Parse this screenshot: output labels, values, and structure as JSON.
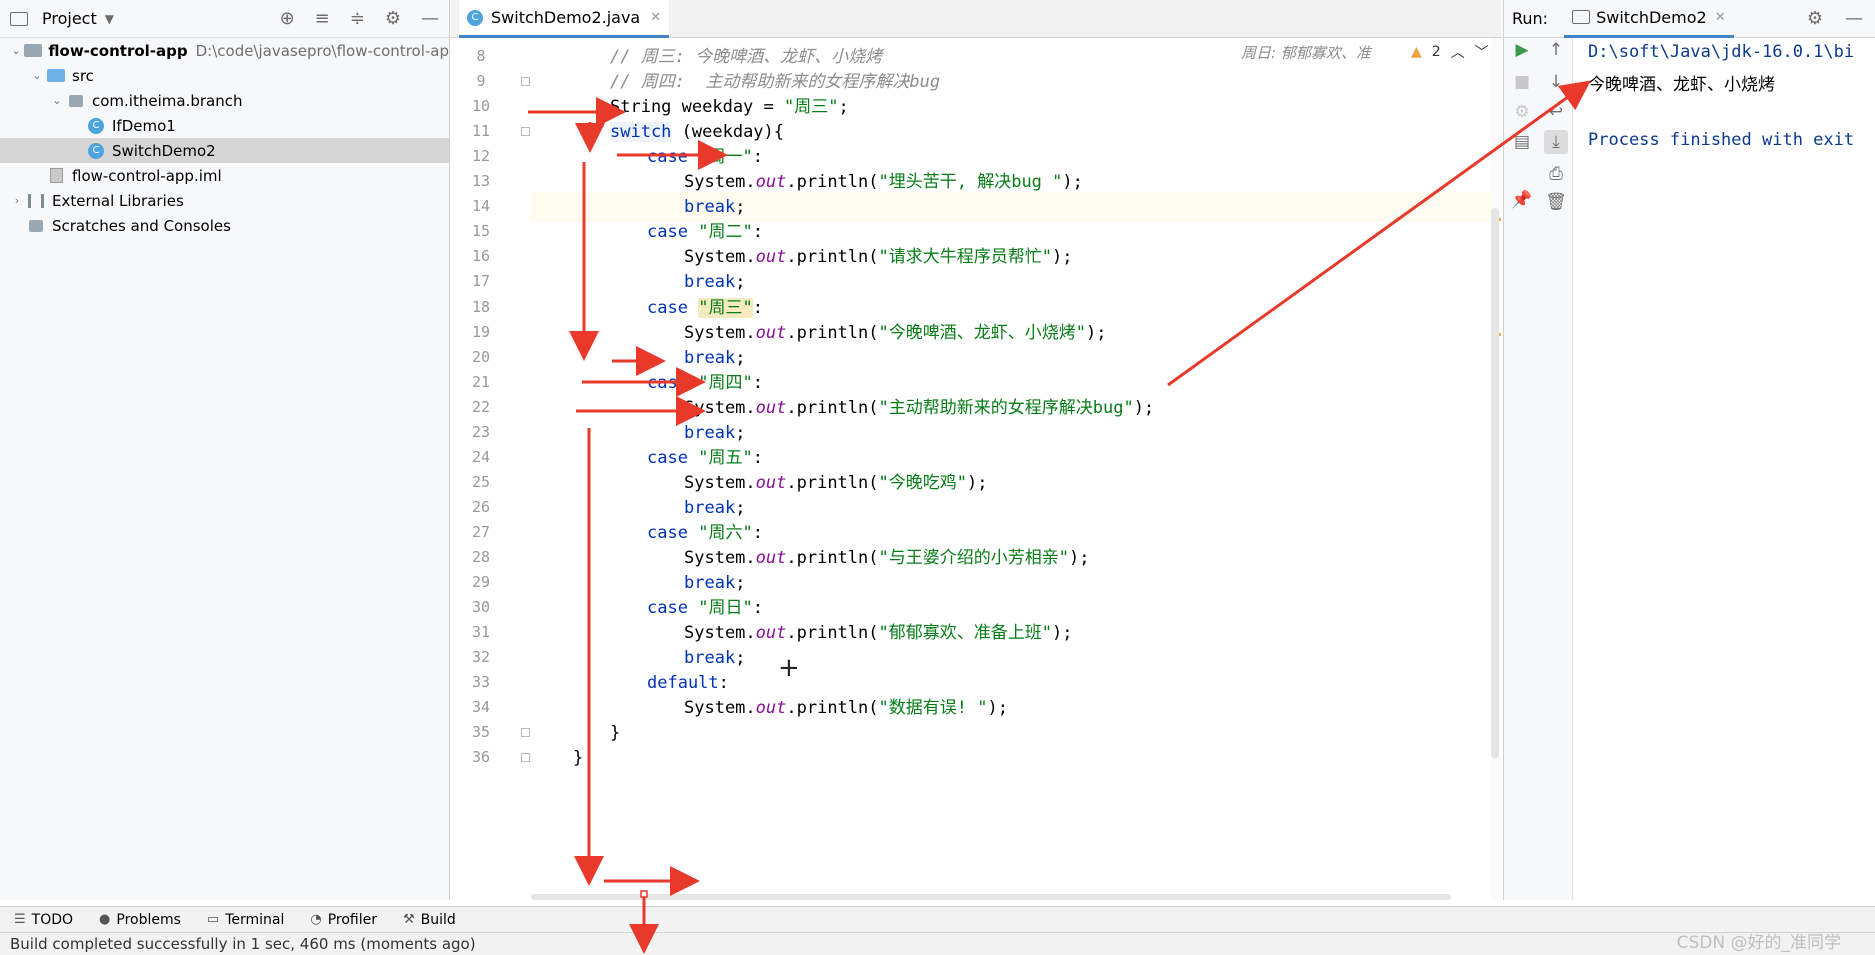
{
  "project": {
    "title": "Project",
    "tree": [
      {
        "label": "flow-control-app",
        "path": "D:\\code\\javasepro\\flow-control-ap",
        "depth": 0,
        "expanded": true,
        "type": "module"
      },
      {
        "label": "src",
        "depth": 1,
        "expanded": true,
        "type": "source-folder"
      },
      {
        "label": "com.itheima.branch",
        "depth": 2,
        "expanded": true,
        "type": "package"
      },
      {
        "label": "IfDemo1",
        "depth": 3,
        "type": "class"
      },
      {
        "label": "SwitchDemo2",
        "depth": 3,
        "type": "class",
        "selected": true
      },
      {
        "label": "flow-control-app.iml",
        "depth": 1,
        "type": "iml"
      },
      {
        "label": "External Libraries",
        "depth": 0,
        "expanded": false,
        "type": "libraries"
      },
      {
        "label": "Scratches and Consoles",
        "depth": 0,
        "type": "scratches"
      }
    ]
  },
  "editor": {
    "tab_label": "SwitchDemo2.java",
    "inlay_hint": "周日: 郁郁寡欢、准",
    "warning_count": "2",
    "lines": [
      {
        "n": "8",
        "text": "// 周三: 今晚啤酒、龙虾、小烧烤"
      },
      {
        "n": "9",
        "text": "// 周四:  主动帮助新来的女程序解决bug"
      },
      {
        "n": "10",
        "text": "String weekday = \"周三\";"
      },
      {
        "n": "11",
        "text": "switch (weekday){"
      },
      {
        "n": "12",
        "text": "case \"周一\":"
      },
      {
        "n": "13",
        "text": "System.out.println(\"埋头苦干, 解决bug \");"
      },
      {
        "n": "14",
        "text": "break;"
      },
      {
        "n": "15",
        "text": "case \"周二\":"
      },
      {
        "n": "16",
        "text": "System.out.println(\"请求大牛程序员帮忙\");"
      },
      {
        "n": "17",
        "text": "break;"
      },
      {
        "n": "18",
        "text": "case \"周三\":"
      },
      {
        "n": "19",
        "text": "System.out.println(\"今晚啤酒、龙虾、小烧烤\");"
      },
      {
        "n": "20",
        "text": "break;"
      },
      {
        "n": "21",
        "text": "case \"周四\":"
      },
      {
        "n": "22",
        "text": "System.out.println(\"主动帮助新来的女程序解决bug\");"
      },
      {
        "n": "23",
        "text": "break;"
      },
      {
        "n": "24",
        "text": "case \"周五\":"
      },
      {
        "n": "25",
        "text": "System.out.println(\"今晚吃鸡\");"
      },
      {
        "n": "26",
        "text": "break;"
      },
      {
        "n": "27",
        "text": "case \"周六\":"
      },
      {
        "n": "28",
        "text": "System.out.println(\"与王婆介绍的小芳相亲\");"
      },
      {
        "n": "29",
        "text": "break;"
      },
      {
        "n": "30",
        "text": "case \"周日\":"
      },
      {
        "n": "31",
        "text": "System.out.println(\"郁郁寡欢、准备上班\");"
      },
      {
        "n": "32",
        "text": "break;"
      },
      {
        "n": "33",
        "text": "default:"
      },
      {
        "n": "34",
        "text": "System.out.println(\"数据有误! \");"
      },
      {
        "n": "35",
        "text": "}"
      },
      {
        "n": "36",
        "text": "}"
      }
    ]
  },
  "run": {
    "label": "Run:",
    "tab_label": "SwitchDemo2",
    "console": [
      "D:\\soft\\Java\\jdk-16.0.1\\bi",
      "今晚啤酒、龙虾、小烧烤",
      "",
      "Process finished with exit"
    ]
  },
  "tool_windows": [
    "TODO",
    "Problems",
    "Terminal",
    "Profiler",
    "Build"
  ],
  "status_bar": {
    "message": "Build completed successfully in 1 sec, 460 ms (moments ago)"
  },
  "watermark": "CSDN @好的_准同学",
  "colors": {
    "keyword": "#0033b3",
    "string": "#067d17",
    "comment": "#8c8c8c",
    "field": "#871094",
    "annotation_arrow": "#e8392b",
    "accent": "#4083c9"
  }
}
